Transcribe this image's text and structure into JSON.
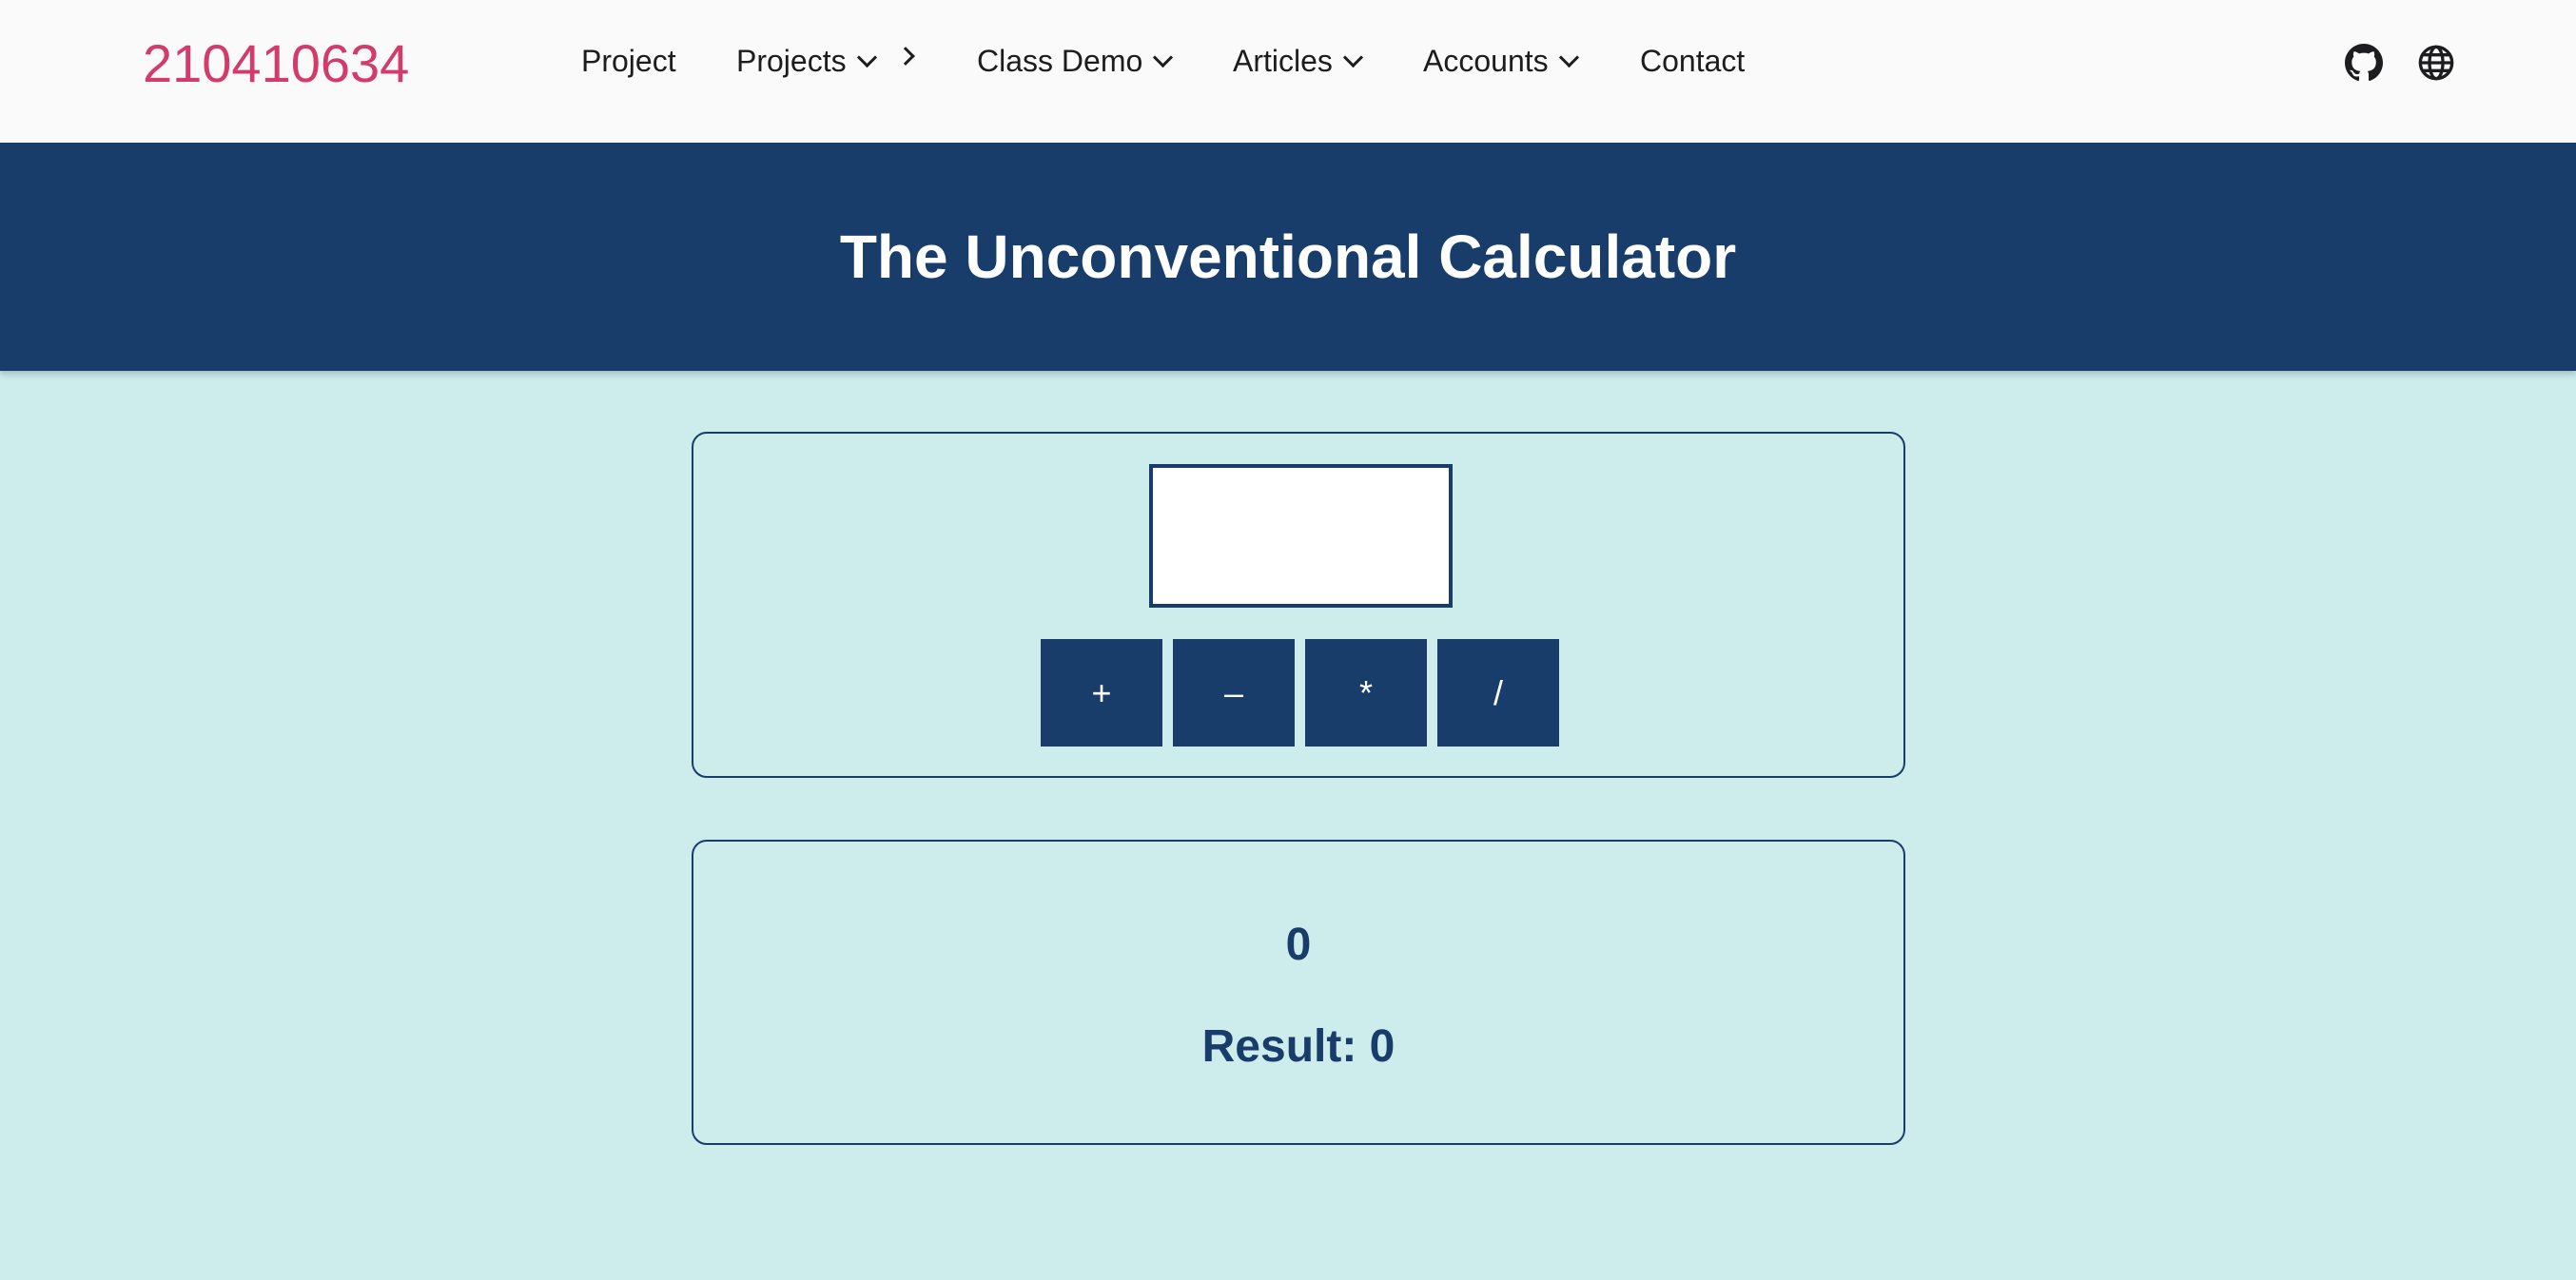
{
  "navbar": {
    "brand": "210410634",
    "items": [
      {
        "label": "Project"
      },
      {
        "label": "Projects"
      },
      {
        "label": "Class Demo"
      },
      {
        "label": "Articles"
      },
      {
        "label": "Accounts"
      },
      {
        "label": "Contact"
      }
    ],
    "icons": [
      "github-icon",
      "globe-icon"
    ]
  },
  "hero": {
    "title": "The Unconventional Calculator"
  },
  "calculator": {
    "input_value": "",
    "operators": [
      "+",
      "–",
      "*",
      "/"
    ]
  },
  "output": {
    "current_value": "0",
    "result_label": "Result: 0"
  },
  "colors": {
    "brand": "#d23b6a",
    "primary": "#193d6b",
    "background": "#cdecec",
    "navbar": "#fafafa"
  }
}
